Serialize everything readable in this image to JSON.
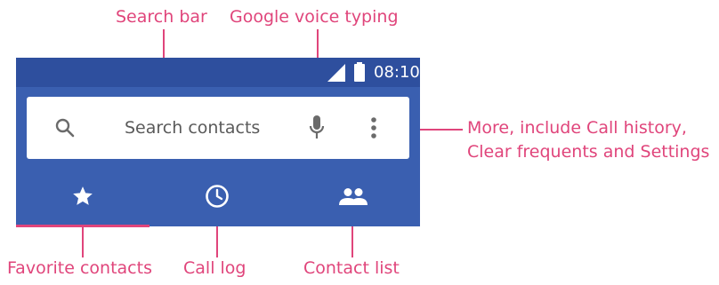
{
  "annotations": {
    "search_bar": "Search bar",
    "voice_typing": "Google voice typing",
    "more_line1": "More, include Call history,",
    "more_line2": "Clear frequents and Settings",
    "favorites": "Favorite contacts",
    "call_log": "Call log",
    "contact_list": "Contact list"
  },
  "status_bar": {
    "time": "08:10"
  },
  "search": {
    "placeholder": "Search contacts"
  },
  "tabs": [
    {
      "icon": "star-icon",
      "selected": true
    },
    {
      "icon": "clock-icon",
      "selected": false
    },
    {
      "icon": "people-icon",
      "selected": false
    }
  ],
  "colors": {
    "annotation": "#e0457b",
    "app_bar": "#3a5fb0",
    "status_bar": "#2e4f9e",
    "search_bg": "#ffffff"
  }
}
